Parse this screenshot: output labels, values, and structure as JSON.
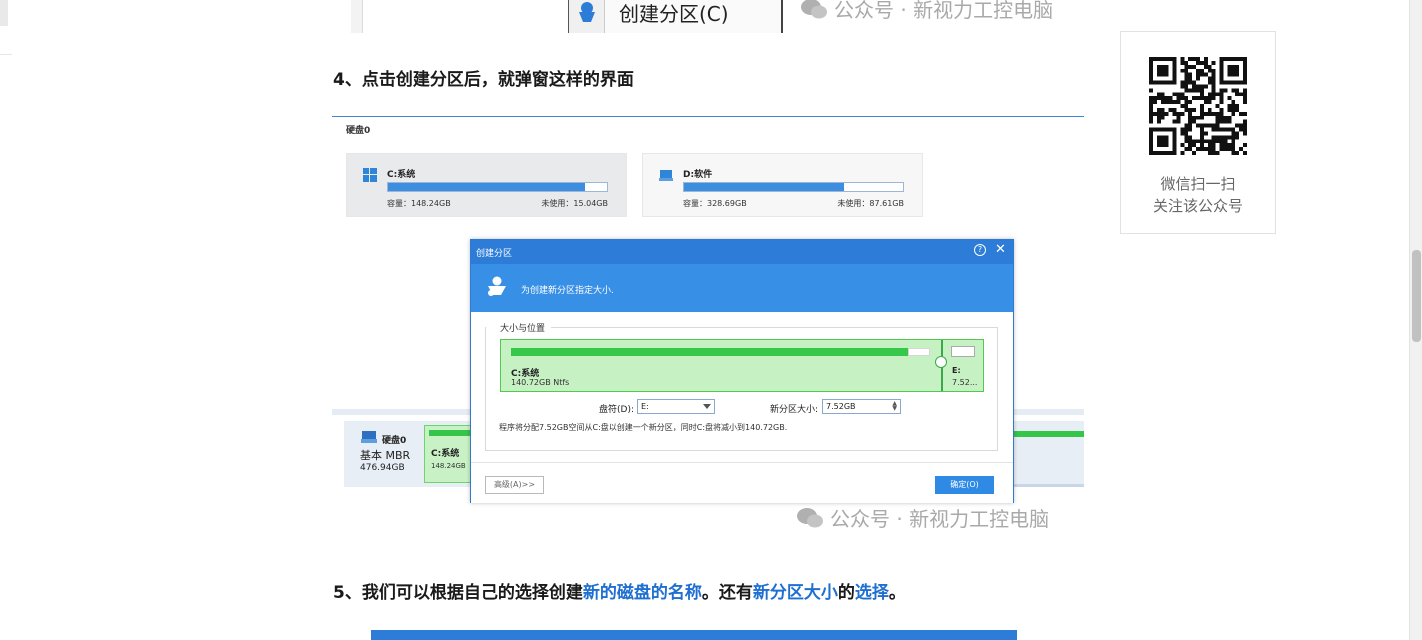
{
  "top_menu_item": "创建分区(C)",
  "watermark": "公众号 · 新视力工控电脑",
  "heading4": "4、点击创建分区后，就弹窗这样的界面",
  "heading5": {
    "prefix": "5、我们可以根据自己的选择创建",
    "hl1": "新的磁盘的名称",
    "mid": "。还有",
    "hl2": "新分区大小",
    "de": "的",
    "hl3": "选择",
    "end": "。"
  },
  "disk_panel": {
    "title": "硬盘0",
    "volumes": [
      {
        "name": "C:系统",
        "capacity": "容量：148.24GB",
        "free": "未使用：15.04GB",
        "used_fraction": 0.9
      },
      {
        "name": "D:软件",
        "capacity": "容量：328.69GB",
        "free": "未使用：87.61GB",
        "used_fraction": 0.73
      }
    ],
    "bottom": {
      "disk_name": "硬盘0",
      "disk_type": "基本 MBR",
      "disk_size": "476.94GB",
      "part_name": "C:系统",
      "part_size": "148.24GB"
    }
  },
  "dialog": {
    "title": "创建分区",
    "header_text": "为创建新分区指定大小.",
    "group_title": "大小与位置",
    "existing_part_name": "C:系统",
    "existing_part_size": "140.72GB Ntfs",
    "new_part_name": "E:",
    "new_part_size": "7.52...",
    "drive_letter_label": "盘符(D):",
    "drive_letter_value": "E:",
    "size_label": "新分区大小:",
    "size_value": "7.52GB",
    "info": "程序将分配7.52GB空间从C:盘以创建一个新分区，同时C:盘将减小到140.72GB.",
    "advanced_button": "高级(A)>>",
    "ok_button": "确定(O)",
    "help_icon": "?",
    "close_icon": "✕",
    "existing_fraction": 0.949
  },
  "qr_card": {
    "caption1": "微信扫一扫",
    "caption2": "关注该公众号"
  },
  "colors": {
    "accent_blue": "#2d7dd8",
    "highlight_text": "#1f6fd1",
    "partition_green": "#37c74a"
  }
}
